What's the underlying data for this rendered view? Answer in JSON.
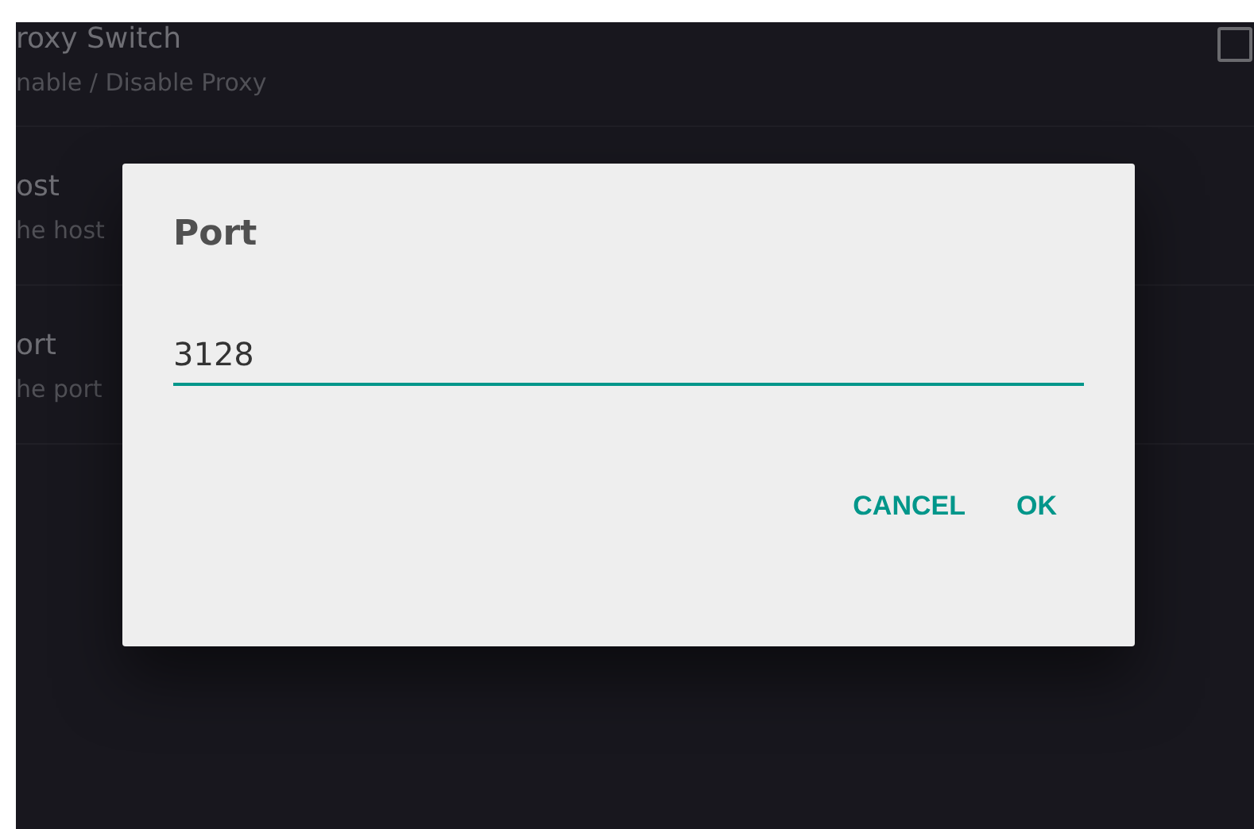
{
  "settings": [
    {
      "kind": "switch",
      "title": "roxy Switch",
      "summary": "nable / Disable Proxy",
      "checked": false
    },
    {
      "kind": "text",
      "title": "ost",
      "summary": "he host"
    },
    {
      "kind": "text",
      "title": "ort",
      "summary": "he port"
    }
  ],
  "dialog": {
    "title": "Port",
    "value": "3128",
    "buttons": [
      "CANCEL",
      "OK"
    ]
  }
}
